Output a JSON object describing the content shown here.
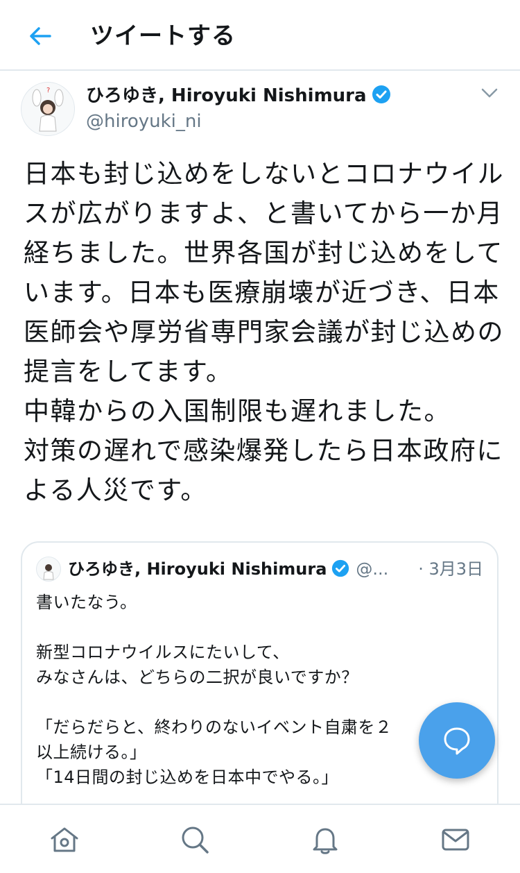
{
  "header": {
    "title": "ツイートする"
  },
  "author": {
    "display_name": "ひろゆき, Hiroyuki Nishimura",
    "handle": "@hiroyuki_ni"
  },
  "tweet": {
    "text": "日本も封じ込めをしないとコロナウイルスが広がりますよ、と書いてから一か月経ちました。世界各国が封じ込めをしています。日本も医療崩壊が近づき、日本医師会や厚労省専門家会議が封じ込めの提言をしてます。\n中韓からの入国制限も遅れました。\n対策の遅れで感染爆発したら日本政府による人災です。"
  },
  "quoted_tweet": {
    "display_name": "ひろゆき, Hiroyuki Nishimura",
    "handle": "@...",
    "date": "· 3月3日",
    "text": "書いたなう。\n\n新型コロナウイルスにたいして、\nみなさんは、どちらの二択が良いですか？\n\n「だらだらと、終わりのないイベント自粛を２\n以上続ける。」\n「14日間の封じ込めを日本中でやる。」"
  },
  "colors": {
    "accent": "#1da1f2",
    "fab": "#4aa1eb",
    "muted": "#657786",
    "border": "#e1e8ed"
  },
  "icons": {
    "back": "arrow-left-icon",
    "verified": "verified-badge-icon",
    "caret": "chevron-down-icon",
    "compose": "speech-bubble-icon",
    "tabs": [
      "home-icon",
      "search-icon",
      "bell-icon",
      "mail-icon"
    ]
  }
}
